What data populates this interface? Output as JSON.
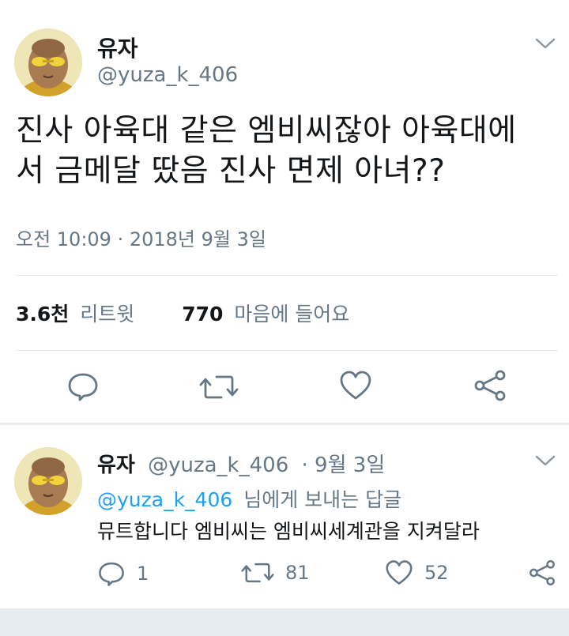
{
  "tweet": {
    "display_name": "유자",
    "handle": "@yuza_k_406",
    "text_line1": "진사 아육대 같은 엠비씨잖아 아육대에",
    "text_line2": "서 금메달 땄음 진사 면제 아녀??",
    "timestamp": "오전 10:09 · 2018년 9월 3일",
    "retweet_count": "3.6천",
    "retweet_label": "리트윗",
    "like_count": "770",
    "like_label": "마음에 들어요",
    "icons": [
      "reply-icon",
      "retweet-icon",
      "like-icon",
      "share-icon",
      "chevron-down-icon"
    ]
  },
  "reply": {
    "display_name": "유자",
    "handle": "@yuza_k_406",
    "date": "· 9월 3일",
    "reply_to_handle": "@yuza_k_406",
    "reply_to_suffix": "님에게 보내는 답글",
    "text": "뮤트합니다 엠비씨는 엠비씨세계관을 지켜달라",
    "reply_count": "1",
    "retweet_count": "81",
    "like_count": "52"
  },
  "colors": {
    "text_primary": "#14171a",
    "text_secondary": "#657786",
    "link": "#1da1f2",
    "divider": "#e1e8ed",
    "band": "#e6ecf0"
  }
}
